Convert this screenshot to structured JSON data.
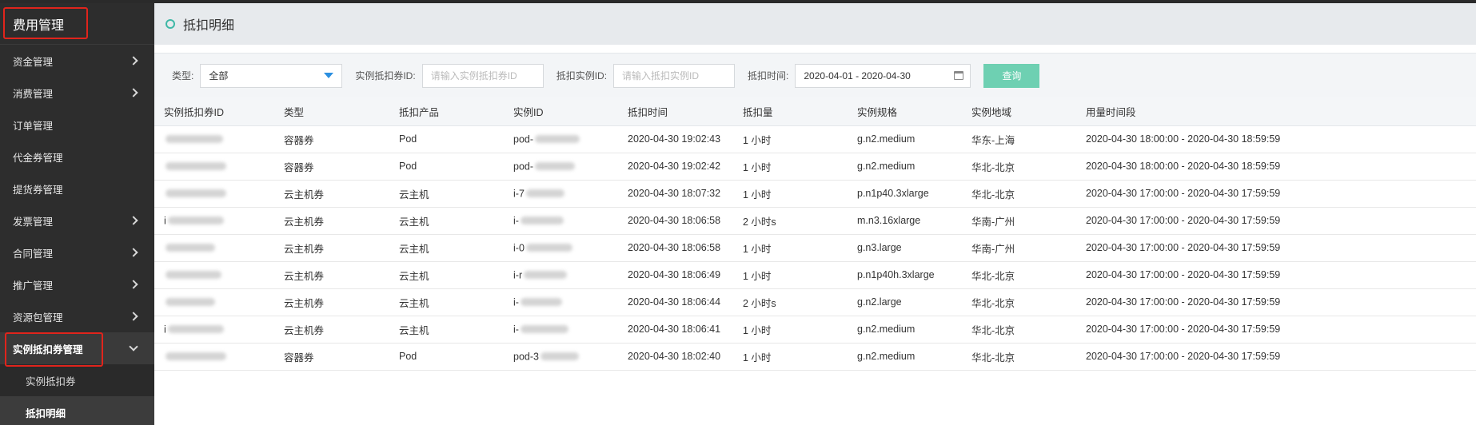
{
  "sidebar": {
    "title": "费用管理",
    "items": [
      {
        "label": "资金管理",
        "expandable": true
      },
      {
        "label": "消费管理",
        "expandable": true
      },
      {
        "label": "订单管理",
        "expandable": false
      },
      {
        "label": "代金券管理",
        "expandable": false
      },
      {
        "label": "提货券管理",
        "expandable": false
      },
      {
        "label": "发票管理",
        "expandable": true
      },
      {
        "label": "合同管理",
        "expandable": true
      },
      {
        "label": "推广管理",
        "expandable": true
      },
      {
        "label": "资源包管理",
        "expandable": true
      }
    ],
    "active_item": {
      "label": "实例抵扣券管理"
    },
    "sub_items": [
      {
        "label": "实例抵扣券"
      },
      {
        "label": "抵扣明细"
      }
    ]
  },
  "header": {
    "title": "抵扣明细"
  },
  "filters": {
    "type_label": "类型:",
    "type_value": "全部",
    "voucher_id_label": "实例抵扣券ID:",
    "voucher_id_placeholder": "请输入实例抵扣券ID",
    "instance_id_label": "抵扣实例ID:",
    "instance_id_placeholder": "请输入抵扣实例ID",
    "time_label": "抵扣时间:",
    "time_value": "2020-04-01 - 2020-04-30",
    "query_button": "查询"
  },
  "table": {
    "columns": [
      "实例抵扣券ID",
      "类型",
      "抵扣产品",
      "实例ID",
      "抵扣时间",
      "抵扣量",
      "实例规格",
      "实例地域",
      "用量时间段"
    ],
    "rows": [
      {
        "voucher_id": "",
        "type": "容器券",
        "product": "Pod",
        "instance_id": "pod-",
        "time": "2020-04-30 19:02:43",
        "amount": "1 小时",
        "spec": "g.n2.medium",
        "region": "华东-上海",
        "period": "2020-04-30 18:00:00 - 2020-04-30 18:59:59"
      },
      {
        "voucher_id": "",
        "type": "容器券",
        "product": "Pod",
        "instance_id": "pod-",
        "time": "2020-04-30 19:02:42",
        "amount": "1 小时",
        "spec": "g.n2.medium",
        "region": "华北-北京",
        "period": "2020-04-30 18:00:00 - 2020-04-30 18:59:59"
      },
      {
        "voucher_id": "",
        "type": "云主机券",
        "product": "云主机",
        "instance_id": "i-7",
        "time": "2020-04-30 18:07:32",
        "amount": "1 小时",
        "spec": "p.n1p40.3xlarge",
        "region": "华北-北京",
        "period": "2020-04-30 17:00:00 - 2020-04-30 17:59:59"
      },
      {
        "voucher_id": "i",
        "type": "云主机券",
        "product": "云主机",
        "instance_id": "i-",
        "time": "2020-04-30 18:06:58",
        "amount": "2 小时s",
        "spec": "m.n3.16xlarge",
        "region": "华南-广州",
        "period": "2020-04-30 17:00:00 - 2020-04-30 17:59:59"
      },
      {
        "voucher_id": "",
        "type": "云主机券",
        "product": "云主机",
        "instance_id": "i-0",
        "time": "2020-04-30 18:06:58",
        "amount": "1 小时",
        "spec": "g.n3.large",
        "region": "华南-广州",
        "period": "2020-04-30 17:00:00 - 2020-04-30 17:59:59"
      },
      {
        "voucher_id": "",
        "type": "云主机券",
        "product": "云主机",
        "instance_id": "i-r",
        "time": "2020-04-30 18:06:49",
        "amount": "1 小时",
        "spec": "p.n1p40h.3xlarge",
        "region": "华北-北京",
        "period": "2020-04-30 17:00:00 - 2020-04-30 17:59:59"
      },
      {
        "voucher_id": "",
        "type": "云主机券",
        "product": "云主机",
        "instance_id": "i-",
        "time": "2020-04-30 18:06:44",
        "amount": "2 小时s",
        "spec": "g.n2.large",
        "region": "华北-北京",
        "period": "2020-04-30 17:00:00 - 2020-04-30 17:59:59"
      },
      {
        "voucher_id": "i",
        "type": "云主机券",
        "product": "云主机",
        "instance_id": "i-",
        "time": "2020-04-30 18:06:41",
        "amount": "1 小时",
        "spec": "g.n2.medium",
        "region": "华北-北京",
        "period": "2020-04-30 17:00:00 - 2020-04-30 17:59:59"
      },
      {
        "voucher_id": "",
        "type": "容器券",
        "product": "Pod",
        "instance_id": "pod-3",
        "time": "2020-04-30 18:02:40",
        "amount": "1 小时",
        "spec": "g.n2.medium",
        "region": "华北-北京",
        "period": "2020-04-30 17:00:00 - 2020-04-30 17:59:59"
      }
    ]
  },
  "colors": {
    "sidebar_bg": "#2d2d2d",
    "highlight_box": "#e0241c",
    "accent_teal": "#6ed0b2",
    "dropdown_arrow": "#2b8fe0"
  }
}
